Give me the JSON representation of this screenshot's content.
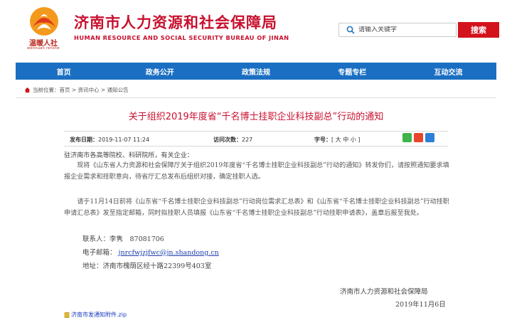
{
  "header": {
    "logo_caption": "温暖人社",
    "logo_sub": "wennuan renshe",
    "title": "济南市人力资源和社会保障局",
    "subtitle": "HUMAN RESOURCE AND SOCIAL SECURITY BUREAU OF JINAN",
    "search_placeholder": "请输入关键字",
    "search_button": "搜索"
  },
  "nav": {
    "items": [
      "首页",
      "政务公开",
      "政策法规",
      "专题专栏",
      "互动交流"
    ]
  },
  "breadcrumb": "当前位置：首页 > 资讯中心 > 通知公告",
  "article": {
    "title": "关于组织2019年度省“千名博士挂职企业科技副总”行动的通知",
    "meta": {
      "publish_label": "发布日期：",
      "publish_value": "2019-11-07 11:24",
      "visits_label": "访问次数：",
      "visits_value": "227",
      "font_label": "字号：",
      "font_value": "[ 大 中 小 ]"
    },
    "greeting": "驻济南市各高等院校、科研院所，有关企业：",
    "para1": "　　现将《山东省人力资源和社会保障厅关于组织2019年度省“千名博士挂职企业科技副总”行动的通知》转发你们，请按照通知要求填报企业需求和挂职意向，待省厅汇总发布后组织对接，确定挂职人选。",
    "para2": "　　请于11月14日前将《山东省“千名博士挂职企业科技副总”行动岗位需求汇总表》和《山东省“千名博士挂职企业科技副总”行动挂职申请汇总表》发至指定邮箱，同时拟挂职人员填报《山东省“千名博士挂职企业科技副总”行动挂职申请表》，盖章后报至我处。",
    "contact_person": "联系人：李隽　87081706",
    "email_label": "电子邮箱：",
    "email_value": "jnrcfwjzjfwc@jn.shandong.cn",
    "address": "地址：济南市槐荫区经十路22399号403室",
    "signer": "济南市人力资源和社会保障局",
    "sign_date": "2019年11月6日",
    "attachment": "济南市发通知附件.zip"
  },
  "colors": {
    "brand_red": "#c8102e",
    "nav_blue": "#1b6fc2",
    "search_red": "#d3121c"
  }
}
